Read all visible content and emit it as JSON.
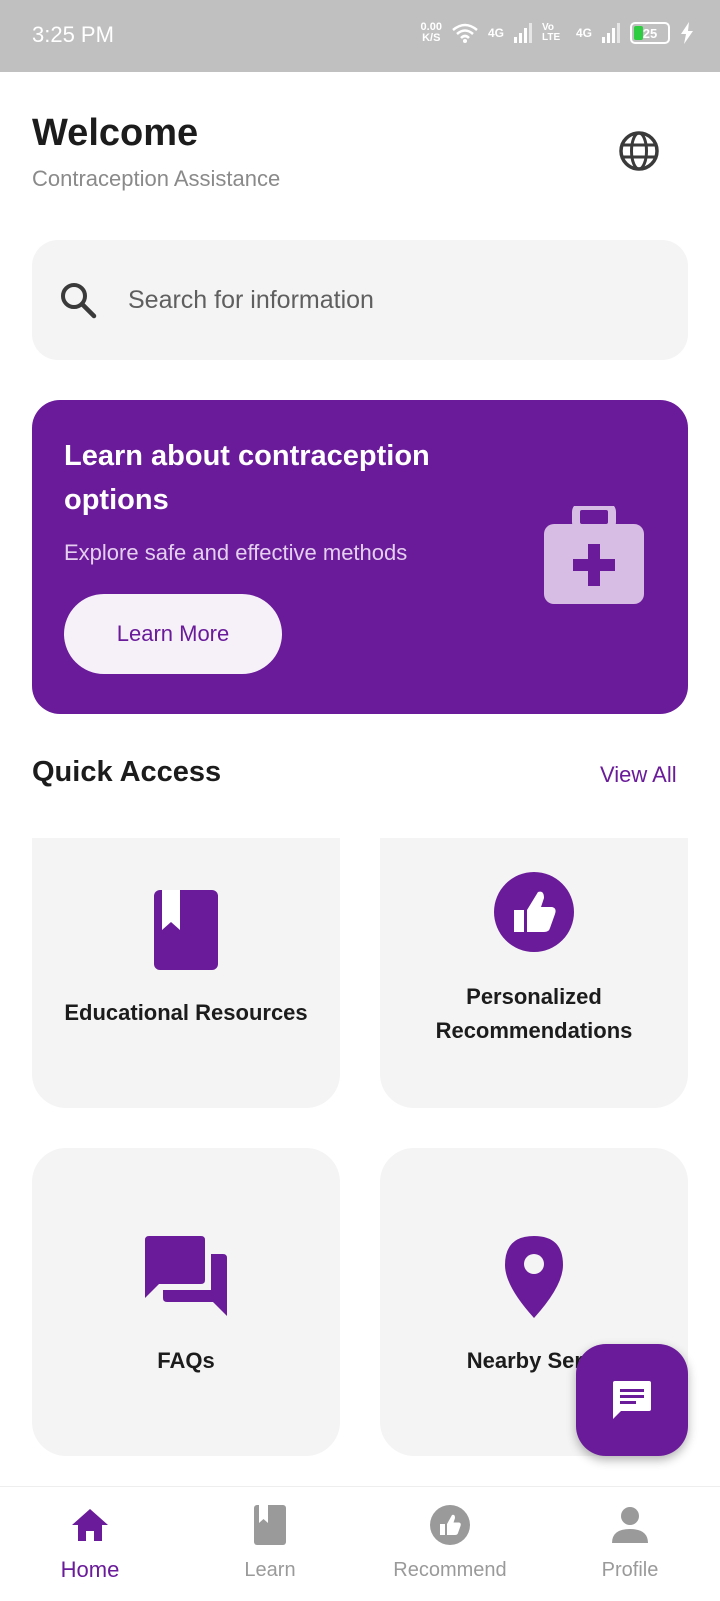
{
  "status_bar": {
    "time": "3:25 PM",
    "speed_value": "0.00",
    "speed_unit": "K/S",
    "network1": "4G",
    "volte": "Vo LTE",
    "network2": "4G",
    "battery": "25"
  },
  "header": {
    "title": "Welcome",
    "subtitle": "Contraception Assistance",
    "globe_icon": "globe-icon"
  },
  "search": {
    "placeholder": "Search for information",
    "icon": "search-icon"
  },
  "banner": {
    "title": "Learn about contraception options",
    "subtitle": "Explore safe and effective methods",
    "button_label": "Learn More",
    "icon": "medical-kit-icon",
    "background": "#6a1b9a"
  },
  "quick_access": {
    "title": "Quick Access",
    "view_all": "View All",
    "cards": [
      {
        "label": "Educational Resources",
        "icon": "book-icon"
      },
      {
        "label": "Personalized Recommendations",
        "icon": "thumbs-up-icon"
      },
      {
        "label": "FAQs",
        "icon": "chat-bubbles-icon"
      },
      {
        "label": "Nearby Servi",
        "icon": "location-pin-icon"
      }
    ]
  },
  "fab": {
    "icon": "chat-icon"
  },
  "bottom_nav": {
    "items": [
      {
        "label": "Home",
        "icon": "home-icon",
        "active": true
      },
      {
        "label": "Learn",
        "icon": "book-icon",
        "active": false
      },
      {
        "label": "Recommend",
        "icon": "thumbs-up-icon",
        "active": false
      },
      {
        "label": "Profile",
        "icon": "person-icon",
        "active": false
      }
    ]
  },
  "colors": {
    "accent": "#6a1b9a",
    "card_bg": "#f4f4f4",
    "inactive": "#9a9a9a"
  }
}
